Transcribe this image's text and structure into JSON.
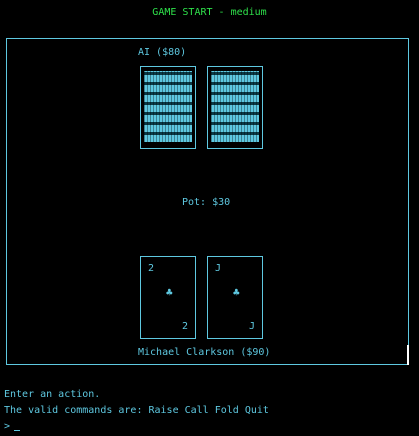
{
  "header": {
    "title": "GAME START - medium"
  },
  "table": {
    "ai_label": "AI ($80)",
    "pot_label": "Pot: $30",
    "player_label": "Michael Clarkson ($90)"
  },
  "ai_hand": [
    {
      "face": "down"
    },
    {
      "face": "down"
    }
  ],
  "player_hand": [
    {
      "rank": "2",
      "suit": "♣",
      "suit_name": "clubs"
    },
    {
      "rank": "J",
      "suit": "♣",
      "suit_name": "clubs"
    }
  ],
  "console": {
    "line1": "Enter an action.",
    "line2": "The valid commands are: Raise Call Fold Quit",
    "prompt": ">",
    "input_value": ""
  },
  "colors": {
    "title": "#2ee04a",
    "text": "#5ec8e0",
    "background": "#000000"
  }
}
